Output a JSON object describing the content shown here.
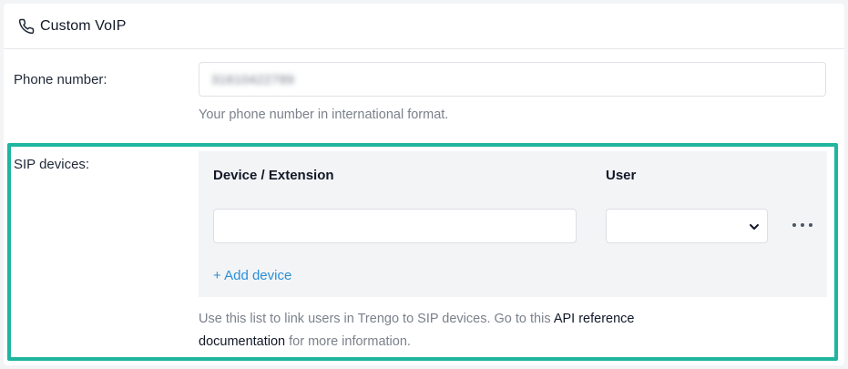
{
  "header": {
    "title": "Custom VoIP",
    "icon": "phone-icon"
  },
  "phone": {
    "label": "Phone number:",
    "value": "31610422789",
    "help": "Your phone number in international format."
  },
  "sip": {
    "label": "SIP devices:",
    "columns": {
      "device": "Device / Extension",
      "user": "User"
    },
    "device_value": "",
    "user_value": "",
    "add_label": "+ Add device",
    "help_pre": "Use this list to link users in Trengo to SIP devices. Go to this ",
    "help_link1": "API reference",
    "help_link2": "documentation",
    "help_post": " for more information."
  },
  "colors": {
    "highlight": "#1fb59f",
    "link": "#2b8fd6"
  }
}
